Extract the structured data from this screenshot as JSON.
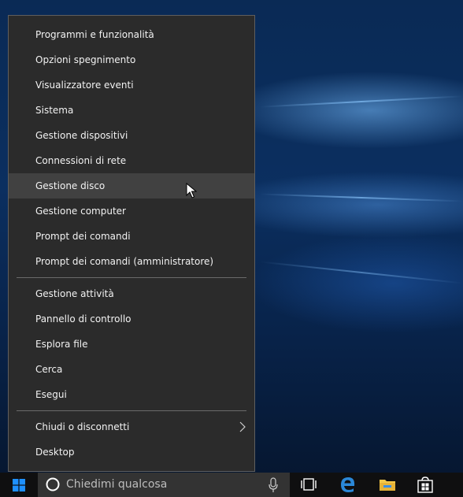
{
  "context_menu": {
    "items": [
      {
        "label": "Programmi e funzionalità"
      },
      {
        "label": "Opzioni spegnimento"
      },
      {
        "label": "Visualizzatore eventi"
      },
      {
        "label": "Sistema"
      },
      {
        "label": "Gestione dispositivi"
      },
      {
        "label": "Connessioni di rete"
      },
      {
        "label": "Gestione disco",
        "highlighted": true
      },
      {
        "label": "Gestione computer"
      },
      {
        "label": "Prompt dei comandi"
      },
      {
        "label": "Prompt dei comandi (amministratore)"
      },
      {
        "label": "Gestione attività"
      },
      {
        "label": "Pannello di controllo"
      },
      {
        "label": "Esplora file"
      },
      {
        "label": "Cerca"
      },
      {
        "label": "Esegui"
      },
      {
        "label": "Chiudi o disconnetti",
        "submenu": true
      },
      {
        "label": "Desktop"
      }
    ]
  },
  "taskbar": {
    "search_placeholder": "Chiedimi qualcosa",
    "icons": [
      "windows-start-icon",
      "cortana-ring-icon",
      "microphone-icon",
      "task-view-icon",
      "edge-icon",
      "file-explorer-icon",
      "store-icon"
    ]
  },
  "colors": {
    "menu_bg": "#2b2b2b",
    "menu_hover": "#414141",
    "menu_text": "#f2f2f2",
    "taskbar_bg": "#0f0f10",
    "search_bg": "#333333",
    "accent_blue": "#1e90ff"
  }
}
